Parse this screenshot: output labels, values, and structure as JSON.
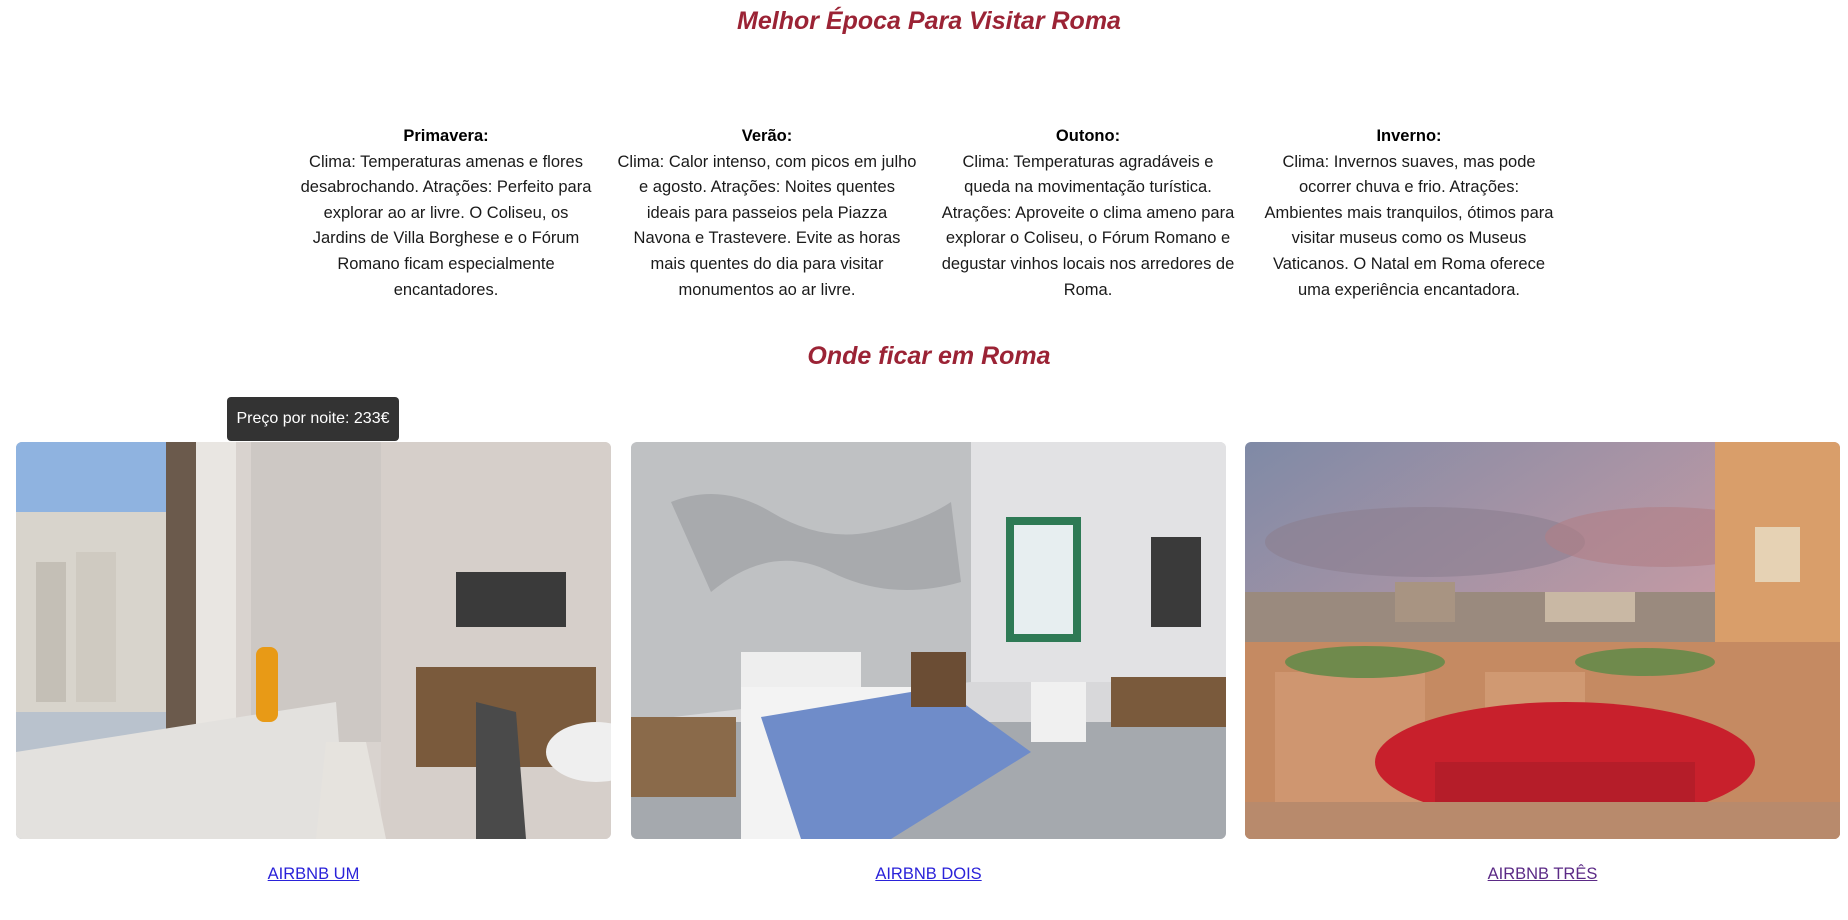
{
  "sections": {
    "best_time_title": "Melhor Época Para Visitar Roma",
    "where_stay_title": "Onde ficar em Roma"
  },
  "seasons": [
    {
      "name": "Primavera:",
      "text": "Clima: Temperaturas amenas e flores desabrochando. Atrações: Perfeito para explorar ao ar livre. O Coliseu, os Jardins de Villa Borghese e o Fórum Romano ficam especialmente encantadores."
    },
    {
      "name": "Verão:",
      "text": "Clima: Calor intenso, com picos em julho e agosto. Atrações: Noites quentes ideais para passeios pela Piazza Navona e Trastevere. Evite as horas mais quentes do dia para visitar monumentos ao ar livre."
    },
    {
      "name": "Outono:",
      "text": "Clima: Temperaturas agradáveis e queda na movimentação turística. Atrações: Aproveite o clima ameno para explorar o Coliseu, o Fórum Romano e degustar vinhos locais nos arredores de Roma."
    },
    {
      "name": "Inverno:",
      "text": "Clima: Invernos suaves, mas pode ocorrer chuva e frio. Atrações: Ambientes mais tranquilos, ótimos para visitar museus como os Museus Vaticanos. O Natal em Roma oferece uma experiência encantadora."
    }
  ],
  "tooltip": "Preço por noite: 233€",
  "listings": [
    {
      "label": "AIRBNB UM"
    },
    {
      "label": "AIRBNB DOIS"
    },
    {
      "label": "AIRBNB TRÊS"
    }
  ],
  "colors": {
    "heading": "#9b2335",
    "link": "#2a22d9",
    "link_visited": "#5b2a86",
    "tooltip_bg": "#333333"
  }
}
